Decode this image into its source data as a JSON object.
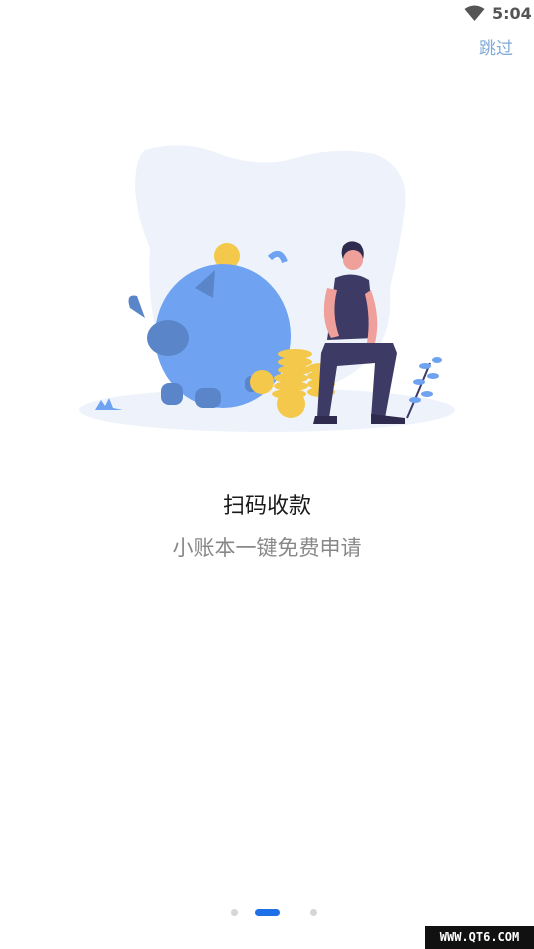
{
  "status_bar": {
    "time": "5:04",
    "wifi_icon": "wifi-icon"
  },
  "header": {
    "skip_label": "跳过"
  },
  "illustration": {
    "icon": "piggy-bank-illustration",
    "colors": {
      "blob": "#eef3fb",
      "pig": "#6fa3f2",
      "pig_shadow": "#5a86c9",
      "coin": "#f4c84a",
      "person_shirt": "#3d3a66",
      "person_skin": "#f0a09a",
      "plant": "#6fa3f2"
    }
  },
  "content": {
    "title": "扫码收款",
    "subtitle": "小账本一键免费申请"
  },
  "pager": {
    "active_index": 1,
    "count": 3,
    "active_color": "#1f6fe8",
    "inactive_color": "#d6d6d6"
  },
  "watermark": {
    "text": "WWW.QT6.COM"
  }
}
